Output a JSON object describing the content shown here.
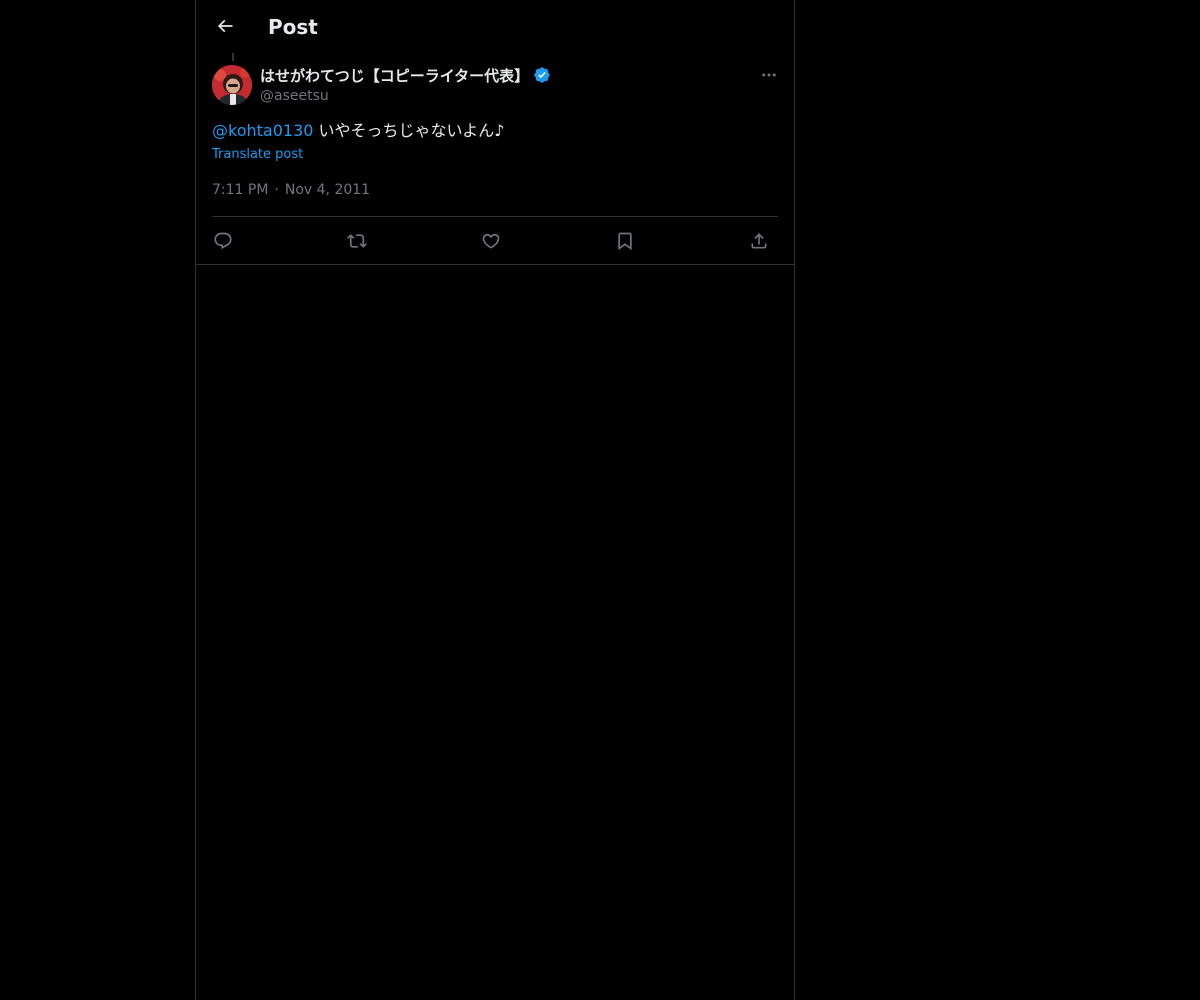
{
  "header": {
    "back_icon": "arrow-left-icon",
    "title": "Post"
  },
  "post": {
    "author": {
      "display_name": "はせがわてつじ【コピーライター代表】",
      "handle": "@aseetsu",
      "verified": true,
      "verified_icon": "verified-badge-icon",
      "avatar": "avatar"
    },
    "more_icon": "more-horizontal-icon",
    "mention": "@kohta0130",
    "text": " いやそっちじゃないよん♪",
    "translate_label": "Translate post",
    "time": "7:11 PM",
    "separator": "·",
    "date": "Nov 4, 2011"
  },
  "actions": [
    {
      "name": "reply",
      "icon": "reply-icon"
    },
    {
      "name": "repost",
      "icon": "repost-icon"
    },
    {
      "name": "like",
      "icon": "heart-icon"
    },
    {
      "name": "bookmark",
      "icon": "bookmark-icon"
    },
    {
      "name": "share",
      "icon": "share-icon"
    }
  ],
  "colors": {
    "background": "#000000",
    "text": "#e7e9ea",
    "secondary_text": "#71767b",
    "accent": "#1d9bf0",
    "border": "#2f3336"
  }
}
